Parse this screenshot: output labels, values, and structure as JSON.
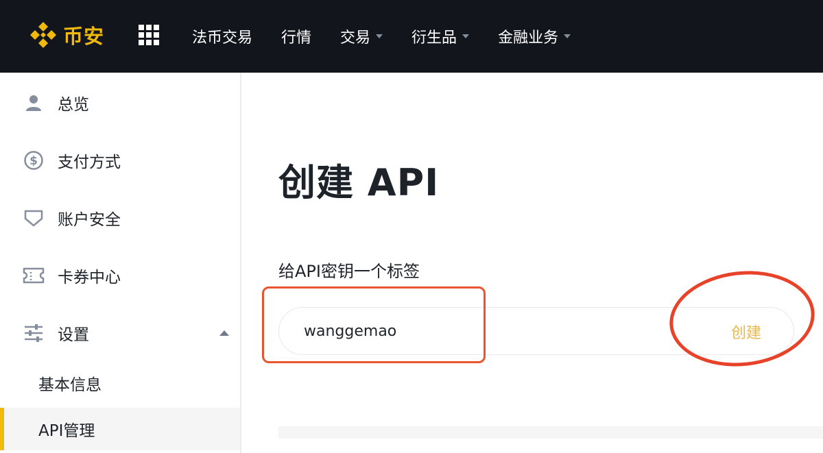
{
  "brand": {
    "name": "币安",
    "color": "#f0b90b"
  },
  "nav": {
    "items": [
      {
        "label": "法币交易",
        "has_dropdown": false
      },
      {
        "label": "行情",
        "has_dropdown": false
      },
      {
        "label": "交易",
        "has_dropdown": true
      },
      {
        "label": "衍生品",
        "has_dropdown": true
      },
      {
        "label": "金融业务",
        "has_dropdown": true
      }
    ]
  },
  "sidebar": {
    "items": [
      {
        "label": "总览",
        "icon": "user-icon"
      },
      {
        "label": "支付方式",
        "icon": "dollar-circle-icon"
      },
      {
        "label": "账户安全",
        "icon": "shield-icon"
      },
      {
        "label": "卡券中心",
        "icon": "ticket-icon"
      },
      {
        "label": "设置",
        "icon": "sliders-icon",
        "expanded": true
      }
    ],
    "sub_items": [
      {
        "label": "基本信息",
        "active": false
      },
      {
        "label": "API管理",
        "active": true
      }
    ]
  },
  "main": {
    "title": "创建 API",
    "field_label": "给API密钥一个标签",
    "input_value": "wanggemao",
    "create_label": "创建"
  },
  "colors": {
    "topbar_bg": "#12161c",
    "accent": "#f0b90b",
    "annotation": "#e8432a"
  }
}
